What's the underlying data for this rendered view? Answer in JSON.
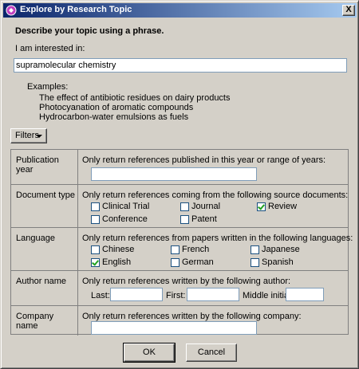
{
  "window": {
    "title": "Explore by Research Topic",
    "close_glyph": "X"
  },
  "heading": "Describe your topic using a phrase.",
  "interest_label": "I am interested in:",
  "phrase_value": "supramolecular chemistry",
  "examples": {
    "title": "Examples:",
    "items": [
      "The effect of antibiotic residues on dairy products",
      "Photocyanation of aromatic compounds",
      "Hydrocarbon-water emulsions as fuels"
    ]
  },
  "filters_label": "Filters",
  "filters": {
    "publication_year": {
      "label": "Publication year",
      "description": "Only return references published in this year or range of years:",
      "value": ""
    },
    "document_type": {
      "label": "Document type",
      "description": "Only return references coming from the following source documents:",
      "options": [
        {
          "label": "Clinical Trial",
          "checked": false
        },
        {
          "label": "Journal",
          "checked": false
        },
        {
          "label": "Review",
          "checked": true
        },
        {
          "label": "Conference",
          "checked": false
        },
        {
          "label": "Patent",
          "checked": false
        }
      ]
    },
    "language": {
      "label": "Language",
      "description": "Only return references from papers written in the following languages:",
      "options": [
        {
          "label": "Chinese",
          "checked": false
        },
        {
          "label": "French",
          "checked": false
        },
        {
          "label": "Japanese",
          "checked": false
        },
        {
          "label": "English",
          "checked": true
        },
        {
          "label": "German",
          "checked": false
        },
        {
          "label": "Spanish",
          "checked": false
        }
      ]
    },
    "author_name": {
      "label": "Author name",
      "description": "Only return references written by the following author:",
      "last_label": "Last:",
      "first_label": "First:",
      "middle_label": "Middle initial:",
      "last_value": "",
      "first_value": "",
      "middle_value": ""
    },
    "company_name": {
      "label": "Company name",
      "description": "Only return references written by the following company:",
      "value": ""
    }
  },
  "buttons": {
    "ok": "OK",
    "cancel": "Cancel"
  },
  "colors": {
    "title_bar_start": "#0a246a",
    "title_bar_end": "#a6caf0",
    "dialog_bg": "#d4d0c8",
    "check_mark": "#21a121"
  }
}
